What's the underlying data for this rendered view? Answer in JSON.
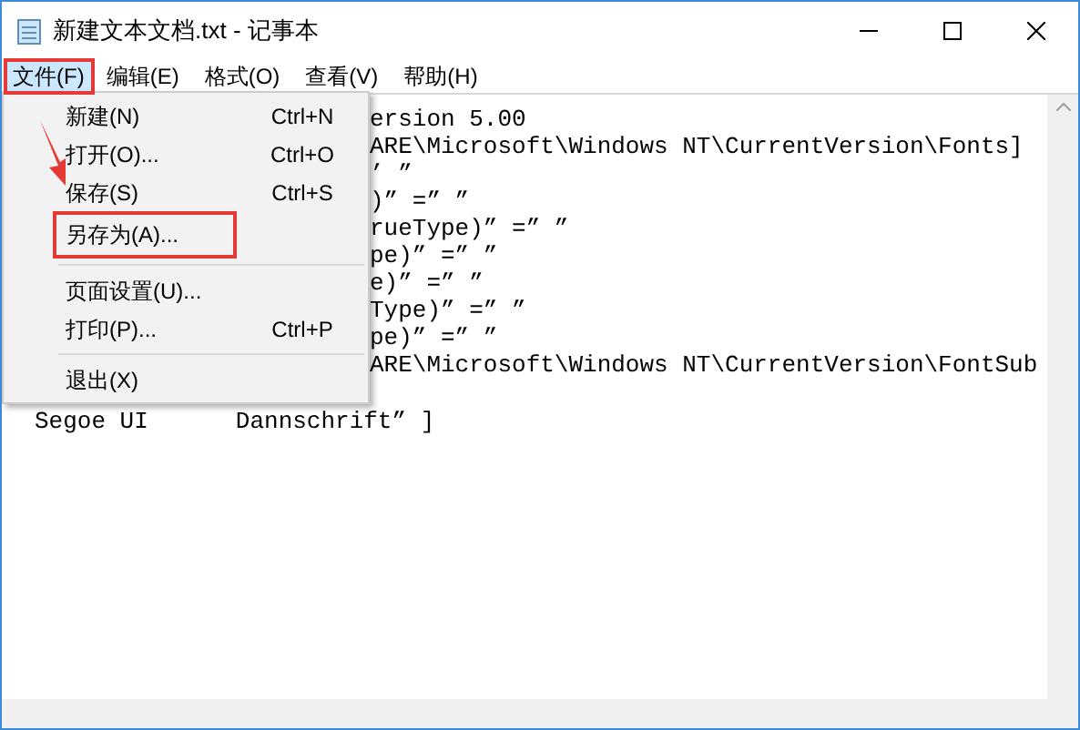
{
  "window": {
    "title": "新建文本文档.txt - 记事本"
  },
  "menu_bar": [
    {
      "label": "文件(F)",
      "selected": true
    },
    {
      "label": "编辑(E)",
      "selected": false
    },
    {
      "label": "格式(O)",
      "selected": false
    },
    {
      "label": "查看(V)",
      "selected": false
    },
    {
      "label": "帮助(H)",
      "selected": false
    }
  ],
  "file_menu": {
    "items": [
      {
        "kind": "item",
        "label": "新建(N)",
        "shortcut": "Ctrl+N"
      },
      {
        "kind": "item",
        "label": "打开(O)...",
        "shortcut": "Ctrl+O"
      },
      {
        "kind": "item",
        "label": "保存(S)",
        "shortcut": "Ctrl+S"
      },
      {
        "kind": "item",
        "label": "另存为(A)...",
        "outlined": true
      },
      {
        "kind": "separator"
      },
      {
        "kind": "item",
        "label": "页面设置(U)..."
      },
      {
        "kind": "item",
        "label": "打印(P)...",
        "shortcut": "Ctrl+P"
      },
      {
        "kind": "separator"
      },
      {
        "kind": "item",
        "label": "退出(X)"
      }
    ]
  },
  "editor": {
    "visible_fragments": [
      "ersion 5.00",
      "ARE\\Microsoft\\Windows NT\\CurrentVersion\\Fonts]",
      "’ ”",
      ")” =” ”",
      "rueType)” =” ”",
      "pe)” =” ”",
      "e)” =” ”",
      "Type)” =” ”",
      "pe)” =” ”",
      "ARE\\Microsoft\\Windows NT\\CurrentVersion\\FontSub"
    ],
    "last_line": [
      "Segoe UI",
      "Dannschrift” ]"
    ]
  }
}
